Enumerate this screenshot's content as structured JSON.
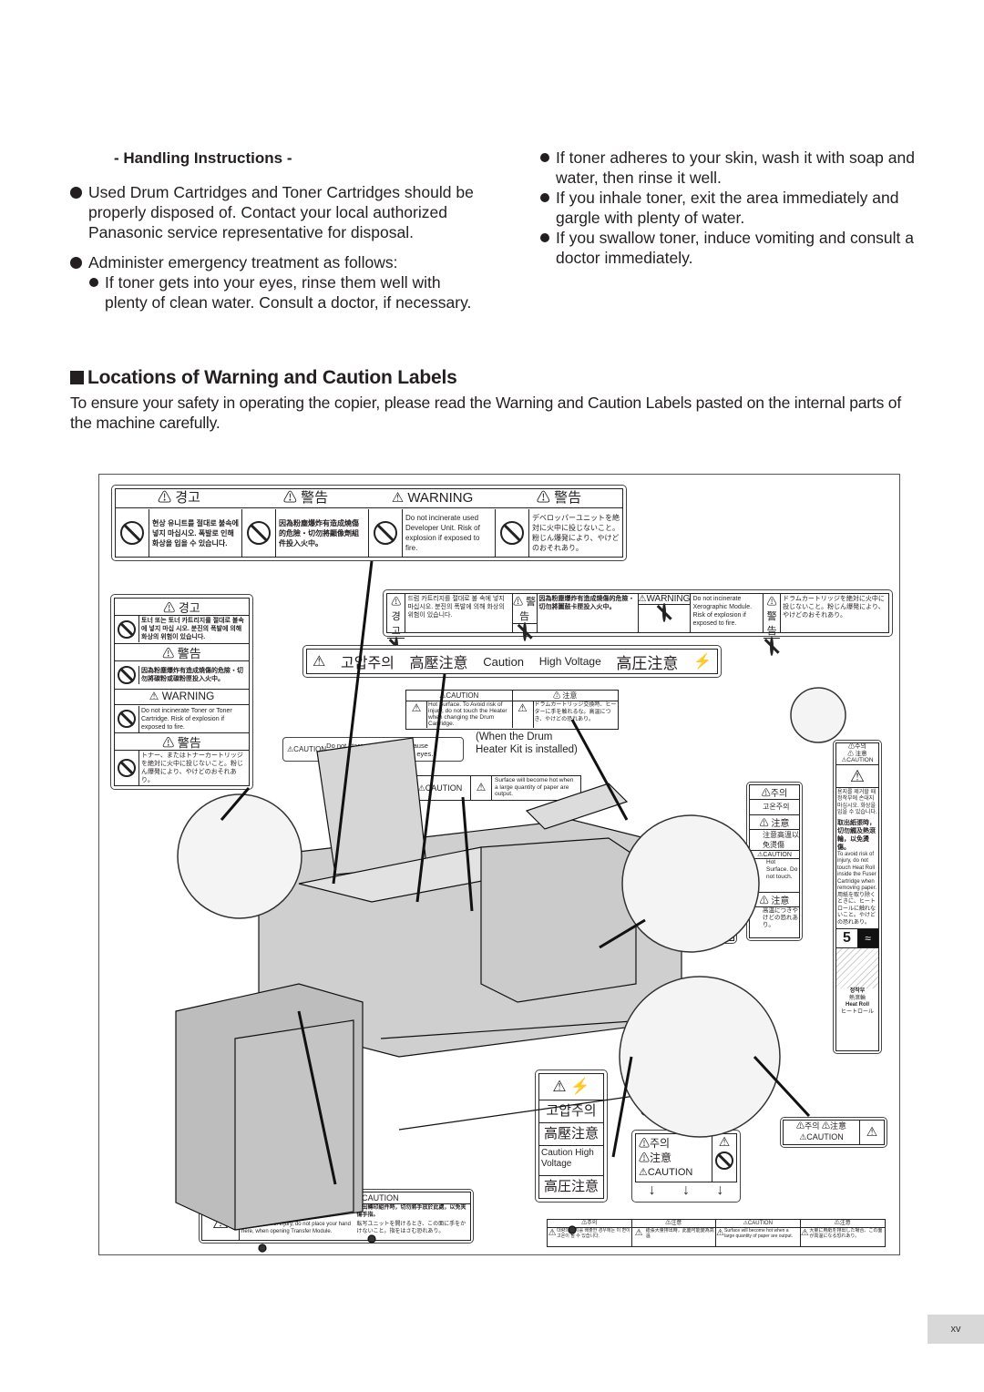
{
  "handling": {
    "title": "- Handling Instructions -",
    "bullet1": "Used Drum Cartridges and Toner Cartridges should be properly disposed of.  Contact your local authorized Panasonic service representative for disposal.",
    "bullet2": "Administer emergency treatment as follows:",
    "sub_eyes": "If toner gets into your eyes, rinse them well with plenty of clean water.  Consult a doctor, if necessary.",
    "sub_skin": "If toner adheres to your skin, wash it with soap and water, then rinse it well.",
    "sub_inhale": "If you inhale toner, exit the area immediately and gargle with plenty of water.",
    "sub_swallow": "If you swallow toner, induce vomiting and consult a doctor immediately."
  },
  "section": {
    "title": "Locations of Warning and Caution Labels",
    "intro": "To ensure your safety in operating the copier, please read the Warning and Caution Labels pasted on the internal parts of the machine carefully."
  },
  "labels": {
    "developer": {
      "headers": [
        "⚠ 경고",
        "⚠ 警告",
        "⚠ WARNING",
        "⚠ 警告"
      ],
      "texts": [
        "현상 유니트를 절대로 불속에 넣지 마십시오. 폭발로 인해 화상을 입을 수 있습니다.",
        "因為粉塵爆炸有造成燒傷的危險・切勿將顯像劑組件投入火中。",
        "Do not incinerate used Developer Unit. Risk of explosion if exposed to fire.",
        "デベロッパーユニットを絶対に火中に投じないこと。粉じん爆発により、やけどのおそれあり。"
      ]
    },
    "xerographic": {
      "headers": [
        "⚠경 고",
        "⚠ 警告",
        "⚠WARNING",
        "⚠ 警告"
      ],
      "texts": [
        "드럼 카트리지를 절대로 불 속에 넣지 마십시오. 분진의 폭발에 의해 화상의 위험이 있습니다.",
        "因為粉塵爆炸有造成燒傷的危險・切勿將圖鼓卡匣投入火中。",
        "Do not incinerate Xerographic Module. Risk of explosion if exposed to fire.",
        "ドラムカートリッジを絶対に火中に投じないこと。粉じん爆発により、やけどのおそれあり。"
      ]
    },
    "toner": {
      "headers": [
        "⚠ 경고",
        "⚠ 警告",
        "⚠ WARNING",
        "⚠ 警告"
      ],
      "texts": [
        "토너 또는 토너 카트리지를 절대로 불속에 넣지 마십 시오. 분진의 폭발에 의해 화상의 위험이 있습니다.",
        "因為粉塵爆炸有造成燒傷的危險・切勿將碳粉或碳粉匣投入火中。",
        "Do not incinerate Toner or Toner Cartridge. Risk of explosion if exposed to fire.",
        "トナー、またはトナーカートリッジを絶対に火中に投じないこと。粉じん爆発により、やけどのおそれあり。"
      ]
    },
    "high_voltage_strip": {
      "parts": [
        "고압주의",
        "高壓注意",
        "Caution",
        "High Voltage",
        "高圧注意"
      ]
    },
    "drum_heater": {
      "headers": [
        "⚠CAUTION",
        "⚠ 注意"
      ],
      "texts": [
        "Hot Surface. To Avoid risk of injury, do not touch the Heater when changing the Drum Cartridge.",
        "ドラムカートリッジ交換時、ヒーターに手を触れるな。高温につき、やけどの恐れあり。"
      ],
      "note": "(When the Drum Heater Kit is installed)"
    },
    "light": {
      "header": "⚠CAUTION",
      "text": "Do not stare at light.  It may cause discomfort or irritation to your eyes."
    },
    "output_hot": {
      "header": "⚠CAUTION",
      "text": "Surface will become hot when a large quantity of paper are output."
    },
    "fuser_side": {
      "rows": [
        "⚠주의",
        "고온주의",
        "⚠ 注意",
        "注意高溫以免燙傷",
        "⚠CAUTION",
        "Hot Surface. Do not touch.",
        "⚠ 注意",
        "高温につきやけどの恐れあり。"
      ]
    },
    "fuser_tall": {
      "head1": "⚠주의",
      "head2": "⚠ 注意",
      "head3": "⚠CAUTION",
      "ko": "용지를 제거할 때 정착부에 손대지 마십시오. 화상을 입을 수 있습니다.",
      "zh": "取出紙張時，切勿觸及熱滾輪，以免燙傷。",
      "en": "To avoid risk of injury, do not touch Heat Roll inside the Fuser Cartridge when removing paper.",
      "ja": "用紙を取り除くときに、ヒートロールに触れないこと。やけどの恐れあり。",
      "number": "5",
      "heat_roll": [
        "정착부",
        "熱滾輪",
        "Heat Roll",
        "ヒートロール"
      ]
    },
    "hand_small": {
      "lines": [
        "⚠ 주의",
        "⚠ 注意",
        "⚠CAUTION"
      ]
    },
    "hv_vertical": {
      "rows": [
        "고압주의",
        "高壓注意",
        "Caution High Voltage",
        "高圧注意"
      ]
    },
    "caution_arrows": {
      "lines": [
        "⚠주의",
        "⚠注意",
        "⚠CAUTION"
      ]
    },
    "transfer": {
      "headers": [
        "⚠주의",
        "⚠注意",
        "⚠CAUTION"
      ],
      "ko": "정착부를 열 때 이 면에 손 대지 마십시오. 손을 다칠 수 있습니다.",
      "zh": "拉出轉印組件時，切勿將手放於此處，以免夾傷手指。",
      "en": "To avoid risk of injury, do not place your hand here, when opening Transfer Module.",
      "ja": "転写ユニットを開けるとき、この面に手をかけないこと。指をはさむ恐れあり。"
    },
    "exit_tray": {
      "headers": [
        "⚠주의",
        "⚠注意",
        "⚠CAUTION",
        "⚠注意"
      ],
      "texts": [
        "대량의 용지를 배출한 경우에는 이 면이 고온이 될 수 있습니다.",
        "紙張大量排出時，此面可能變為高溫",
        "Surface will become hot when a large quantity of paper are output.",
        "大量に用紙を排出した場合、この面が高温になる恐れあり。"
      ]
    },
    "small_caution": {
      "line1": "⚠주의 ⚠注意",
      "line2": "⚠CAUTION"
    }
  },
  "page_number": "xv"
}
